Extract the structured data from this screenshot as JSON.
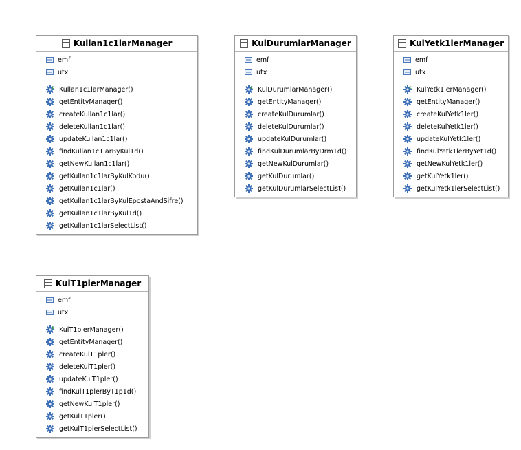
{
  "classes": [
    {
      "name": "Kullan1c1larManager",
      "fields": [
        "emf",
        "utx"
      ],
      "methods": [
        {
          "label": "Kullan1c1larManager()",
          "constructor": true
        },
        {
          "label": "getEntityManager()"
        },
        {
          "label": "createKullan1c1lar()"
        },
        {
          "label": "deleteKullan1c1lar()"
        },
        {
          "label": "updateKullan1c1lar()"
        },
        {
          "label": "findKullan1c1larByKul1d()"
        },
        {
          "label": "getNewKullan1c1lar()"
        },
        {
          "label": "getKullan1c1larByKulKodu()"
        },
        {
          "label": "getKullan1c1lar()"
        },
        {
          "label": "getKullan1c1larByKulEpostaAndSifre()"
        },
        {
          "label": "getKullan1c1larByKul1d()"
        },
        {
          "label": "getKullan1c1larSelectList()"
        }
      ]
    },
    {
      "name": "KulDurumlarManager",
      "fields": [
        "emf",
        "utx"
      ],
      "methods": [
        {
          "label": "KulDurumlarManager()",
          "constructor": true
        },
        {
          "label": "getEntityManager()"
        },
        {
          "label": "createKulDurumlar()"
        },
        {
          "label": "deleteKulDurumlar()"
        },
        {
          "label": "updateKulDurumlar()"
        },
        {
          "label": "findKulDurumlarByDrm1d()"
        },
        {
          "label": "getNewKulDurumlar()"
        },
        {
          "label": "getKulDurumlar()"
        },
        {
          "label": "getKulDurumlarSelectList()"
        }
      ]
    },
    {
      "name": "KulYetk1lerManager",
      "fields": [
        "emf",
        "utx"
      ],
      "methods": [
        {
          "label": "KulYetk1lerManager()",
          "constructor": true
        },
        {
          "label": "getEntityManager()"
        },
        {
          "label": "createKulYetk1ler()"
        },
        {
          "label": "deleteKulYetk1ler()"
        },
        {
          "label": "updateKulYetk1ler()"
        },
        {
          "label": "findKulYetk1lerByYet1d()"
        },
        {
          "label": "getNewKulYetk1ler()"
        },
        {
          "label": "getKulYetk1ler()"
        },
        {
          "label": "getKulYetk1lerSelectList()"
        }
      ]
    },
    {
      "name": "KulT1plerManager",
      "fields": [
        "emf",
        "utx"
      ],
      "methods": [
        {
          "label": "KulT1plerManager()",
          "constructor": true
        },
        {
          "label": "getEntityManager()"
        },
        {
          "label": "createKulT1pler()"
        },
        {
          "label": "deleteKulT1pler()"
        },
        {
          "label": "updateKulT1pler()"
        },
        {
          "label": "findKulT1plerByT1p1d()"
        },
        {
          "label": "getNewKulT1pler()"
        },
        {
          "label": "getKulT1pler()"
        },
        {
          "label": "getKulT1plerSelectList()"
        }
      ]
    }
  ],
  "icons": {
    "class": "class-icon",
    "field": "field-icon",
    "method": "method-gear-icon",
    "constructor": "constructor-gear-icon"
  },
  "colors": {
    "field_icon": "#4a78b8",
    "method_icon": "#3d6fb6",
    "constructor_mark": "#2f9a2f"
  }
}
